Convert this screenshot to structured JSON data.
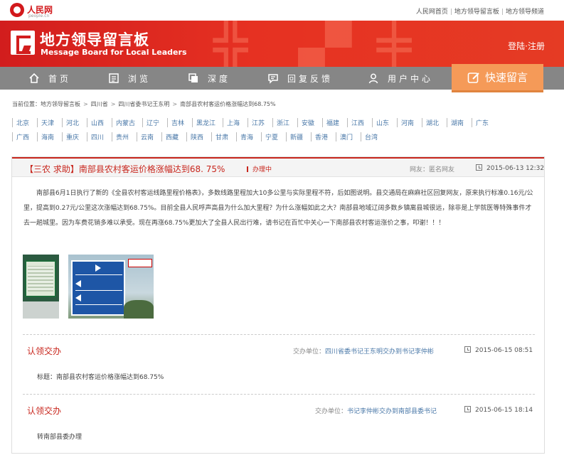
{
  "site": {
    "logo_name": "人民网",
    "logo_domain": "people.cn",
    "top_links": [
      "人民网首页",
      "地方领导留言板",
      "地方领导频道"
    ]
  },
  "banner": {
    "title": "地方领导留言板",
    "subtitle": "Message Board for Local Leaders",
    "login": "登陆·注册"
  },
  "nav": {
    "items": [
      {
        "label": "首页",
        "icon": "home-icon"
      },
      {
        "label": "浏览",
        "icon": "browse-icon"
      },
      {
        "label": "深度",
        "icon": "depth-icon"
      },
      {
        "label": "回复反馈",
        "icon": "reply-feedback-icon"
      },
      {
        "label": "用户中心",
        "icon": "user-icon"
      }
    ],
    "quick_message": "快速留言"
  },
  "breadcrumb": {
    "prefix": "当前位置：",
    "items": [
      "地方领导留言板",
      "四川省",
      "四川省委书记王东明",
      "南部县农村客运价格涨幅达到68.75%"
    ]
  },
  "regions": [
    [
      "北京",
      "天津",
      "河北",
      "山西",
      "内蒙古",
      "辽宁",
      "吉林",
      "黑龙江",
      "上海",
      "江苏",
      "浙江",
      "安徽",
      "福建",
      "江西",
      "山东",
      "河南",
      "湖北",
      "湖南",
      "广东"
    ],
    [
      "广西",
      "海南",
      "重庆",
      "四川",
      "贵州",
      "云南",
      "西藏",
      "陕西",
      "甘肃",
      "青海",
      "宁夏",
      "新疆",
      "香港",
      "澳门",
      "台湾"
    ]
  ],
  "message": {
    "title": "【三农  求助】南部县农村客运价格涨幅达到68. 75%",
    "status": "办理中",
    "author": "网友：匿名网友",
    "time": "2015-06-13 12:32",
    "body": "南部县6月1日执行了新的《全县农村客运线路里程价格表》，多数线路里程加大10多公里与实际里程不符，后如图说明。县交通局在麻麻社区回复网友，原来执行标准0.16元/公里，提高到0.27元/公里这次涨幅达到68.75%。目前全县人民呼声高县为什么加大里程？为什么涨幅如此之大？南部县地域辽阔多数乡镇离县城很远，除非是上学就医等特殊事件才去一趟城里。因为车费花销多难以承受。现在再涨68.75%更加大了全县人民出行难，请书记在百忙中关心一下南部县农村客运涨价之事，叩谢！！！",
    "photos": [
      "notice-board-photo",
      "road-sign-photo"
    ]
  },
  "replies": [
    {
      "title": "认领交办",
      "unit_label": "交办单位：",
      "unit_value": "四川省委书记王东明交办到书记李仲彬",
      "time": "2015-06-15 08:51",
      "body": "标题：南部县农村客运价格涨幅达到68.75%"
    },
    {
      "title": "认领交办",
      "unit_label": "交办单位：",
      "unit_value": "书记李仲彬交办到南部县委书记",
      "time": "2015-06-15 18:14",
      "body": "转南部县委办理"
    }
  ],
  "colors": {
    "brand_red": "#d2191c",
    "nav_gray": "#868686",
    "quick_orange": "#f59a58",
    "link_blue": "#4a78a8"
  }
}
